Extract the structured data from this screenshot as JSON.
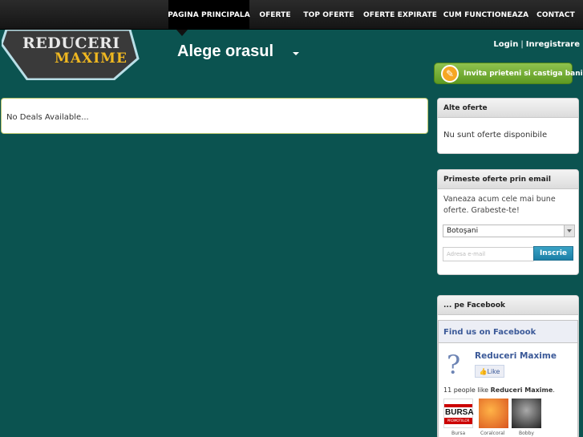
{
  "nav": {
    "items": [
      {
        "label": "PAGINA PRINCIPALA",
        "active": true
      },
      {
        "label": "OFERTE",
        "active": false
      },
      {
        "label": "TOP OFERTE",
        "active": false
      },
      {
        "label": "OFERTE EXPIRATE",
        "active": false
      },
      {
        "label": "CUM FUNCTIONEAZA",
        "active": false
      },
      {
        "label": "CONTACT",
        "active": false
      }
    ]
  },
  "logo": {
    "line1": "REDUCERI",
    "line2": "MAXIME"
  },
  "city_selector": {
    "label": "Alege orasul"
  },
  "auth": {
    "login": "Login",
    "separator": "|",
    "register": "Inregistrare"
  },
  "invite_button": {
    "label": "Invita prieteni si castiga bani",
    "icon": "pencil-icon"
  },
  "deals": {
    "empty_text": "No Deals Available..."
  },
  "other_offers": {
    "title": "Alte oferte",
    "text": "Nu sunt oferte disponibile"
  },
  "email_signup": {
    "title": "Primeste oferte prin email",
    "text": "Vaneaza acum cele mai bune oferte. Grabeste-te!",
    "city_value": "Botoşani",
    "email_placeholder": "Adresa e-mail",
    "button": "Inscrie"
  },
  "facebook": {
    "title": "... pe Facebook",
    "box_title": "Find us on Facebook",
    "page_name": "Reduceri Maxime",
    "like_label": "Like",
    "count_prefix": "11 people like ",
    "count_name": "Reduceri Maxime",
    "count_suffix": ".",
    "thumb_logo_top": "BURSA",
    "thumb_logo_bottom": "PROMOTIILOR",
    "fans": [
      "Bursa",
      "Coralcoral",
      "Bobby"
    ]
  },
  "colors": {
    "background": "#0b5350",
    "accent_green": "#6fa830",
    "facebook_blue": "#3b5998"
  }
}
